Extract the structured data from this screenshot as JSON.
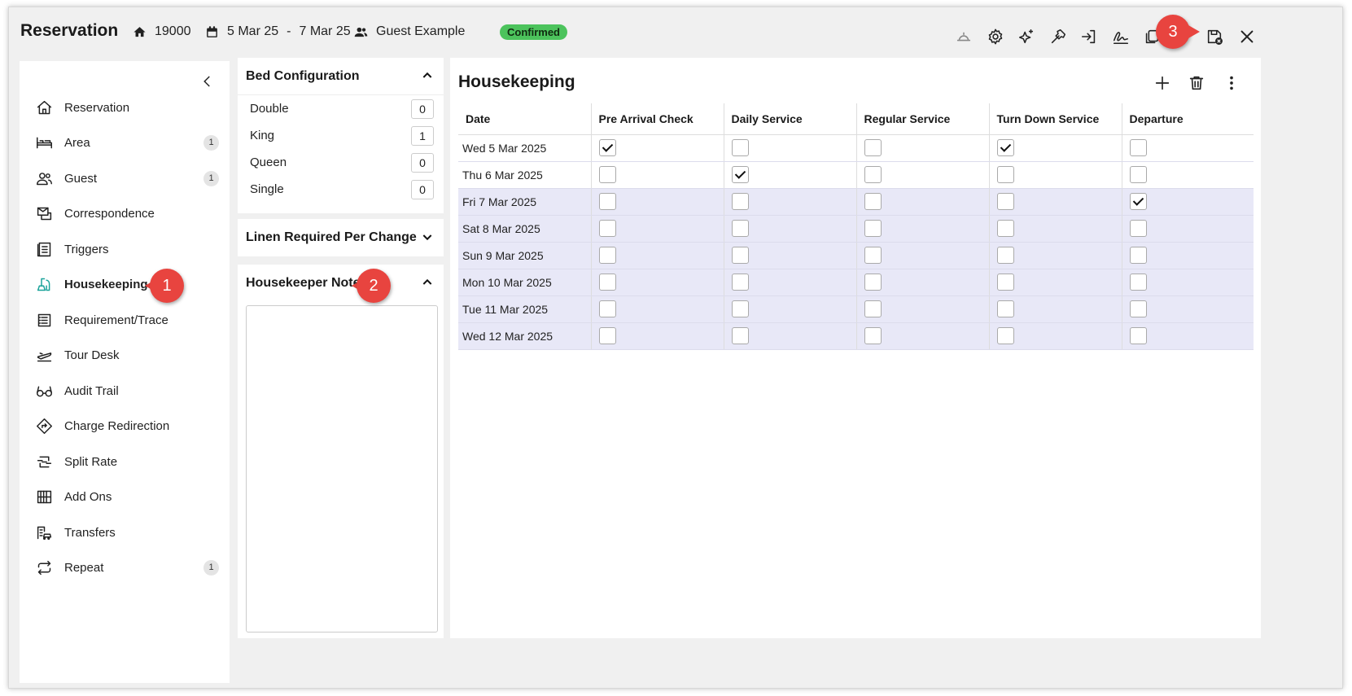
{
  "header": {
    "title": "Reservation",
    "reservation_number": "19000",
    "date_from": "5 Mar 25",
    "date_sep": "-",
    "date_to": "7 Mar 25",
    "guest_name": "Guest Example",
    "status": "Confirmed",
    "status_color": "#4cc35c",
    "tools": [
      "bell-icon",
      "gear-icon",
      "sparkle-icon",
      "hammer-icon",
      "login-icon",
      "signature-icon",
      "copy-icon",
      "save-close-icon",
      "close-icon"
    ]
  },
  "sidebar": {
    "items": [
      {
        "label": "Reservation",
        "icon": "home-icon",
        "count": null
      },
      {
        "label": "Area",
        "icon": "bed-icon",
        "count": "1"
      },
      {
        "label": "Guest",
        "icon": "users-icon",
        "count": "1"
      },
      {
        "label": "Correspondence",
        "icon": "correspondence-icon",
        "count": null
      },
      {
        "label": "Triggers",
        "icon": "triggers-icon",
        "count": null
      },
      {
        "label": "Housekeeping",
        "icon": "housekeeping-icon",
        "count": null,
        "active": true
      },
      {
        "label": "Requirement/Trace",
        "icon": "trace-icon",
        "count": null
      },
      {
        "label": "Tour Desk",
        "icon": "plane-icon",
        "count": null
      },
      {
        "label": "Audit Trail",
        "icon": "glasses-icon",
        "count": null
      },
      {
        "label": "Charge Redirection",
        "icon": "redirect-icon",
        "count": null
      },
      {
        "label": "Split Rate",
        "icon": "split-icon",
        "count": null
      },
      {
        "label": "Add Ons",
        "icon": "abacus-icon",
        "count": null
      },
      {
        "label": "Transfers",
        "icon": "transfers-icon",
        "count": null
      },
      {
        "label": "Repeat",
        "icon": "repeat-icon",
        "count": "1"
      }
    ]
  },
  "bed_config": {
    "title": "Bed Configuration",
    "rows": [
      {
        "label": "Double",
        "value": "0"
      },
      {
        "label": "King",
        "value": "1"
      },
      {
        "label": "Queen",
        "value": "0"
      },
      {
        "label": "Single",
        "value": "0"
      }
    ]
  },
  "linen": {
    "title": "Linen Required Per Change"
  },
  "note": {
    "title": "Housekeeper Note",
    "value": ""
  },
  "main": {
    "title": "Housekeeping",
    "columns": [
      "Date",
      "Pre Arrival Check",
      "Daily Service",
      "Regular Service",
      "Turn Down Service",
      "Departure"
    ],
    "rows": [
      {
        "date": "Wed 5 Mar 2025",
        "checks": [
          true,
          false,
          false,
          true,
          false
        ],
        "hl": false
      },
      {
        "date": "Thu 6 Mar 2025",
        "checks": [
          false,
          true,
          false,
          false,
          false
        ],
        "hl": false
      },
      {
        "date": "Fri 7 Mar 2025",
        "checks": [
          false,
          false,
          false,
          false,
          true
        ],
        "hl": true
      },
      {
        "date": "Sat 8 Mar 2025",
        "checks": [
          false,
          false,
          false,
          false,
          false
        ],
        "hl": true
      },
      {
        "date": "Sun 9 Mar 2025",
        "checks": [
          false,
          false,
          false,
          false,
          false
        ],
        "hl": true
      },
      {
        "date": "Mon 10 Mar 2025",
        "checks": [
          false,
          false,
          false,
          false,
          false
        ],
        "hl": true
      },
      {
        "date": "Tue 11 Mar 2025",
        "checks": [
          false,
          false,
          false,
          false,
          false
        ],
        "hl": true
      },
      {
        "date": "Wed 12 Mar 2025",
        "checks": [
          false,
          false,
          false,
          false,
          false
        ],
        "hl": true
      }
    ]
  },
  "callouts": [
    "1",
    "2",
    "3"
  ]
}
